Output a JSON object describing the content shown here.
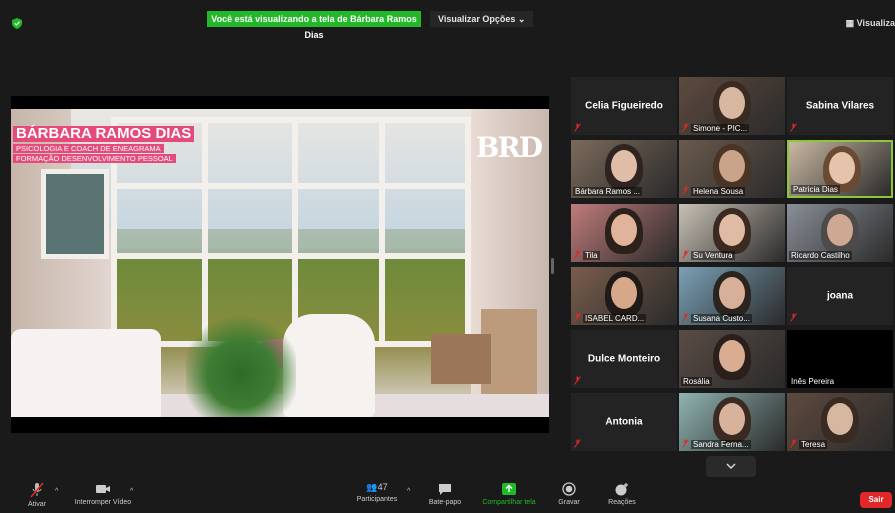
{
  "topbar": {
    "banner": "Você está visualizando a tela de Bárbara Ramos Dias",
    "view_options": "Visualizar Opções ⌄",
    "view_right": "Visualiza"
  },
  "shared_screen": {
    "brand_title": "BÁRBARA RAMOS DIAS",
    "brand_sub1": "PSICOLOGIA E COACH DE ENEAGRAMA",
    "brand_sub2": "FORMAÇÃO DESENVOLVIMENTO PESSOAL",
    "logo": "BRD"
  },
  "participants": [
    {
      "name": "Celia Figueiredo",
      "type": "name",
      "muted": true
    },
    {
      "name": "Simone - PIC...",
      "type": "video",
      "muted": true
    },
    {
      "name": "Sabina Vilares",
      "type": "name",
      "muted": true
    },
    {
      "name": "Bárbara Ramos ...",
      "type": "video",
      "muted": false
    },
    {
      "name": "Helena Sousa",
      "type": "video",
      "muted": true
    },
    {
      "name": "Patricia Dias",
      "type": "video",
      "muted": false,
      "active": true
    },
    {
      "name": "Tila",
      "type": "video",
      "muted": true
    },
    {
      "name": "Su Ventura",
      "type": "video",
      "muted": true
    },
    {
      "name": "Ricardo Castilho",
      "type": "video",
      "muted": false
    },
    {
      "name": "ISABEL CARD...",
      "type": "video",
      "muted": true
    },
    {
      "name": "Susana Custo...",
      "type": "video",
      "muted": true
    },
    {
      "name": "joana",
      "type": "name",
      "muted": true
    },
    {
      "name": "Dulce Monteiro",
      "type": "name",
      "muted": true
    },
    {
      "name": "Rosália",
      "type": "video",
      "muted": false
    },
    {
      "name": "Inês Pereira",
      "type": "video",
      "muted": false
    },
    {
      "name": "Antonia",
      "type": "name",
      "muted": true
    },
    {
      "name": "Sandra Ferna...",
      "type": "video",
      "muted": true
    },
    {
      "name": "Teresa",
      "type": "video",
      "muted": true
    }
  ],
  "toolbar": {
    "mute": "Ativar",
    "video": "Interromper Vídeo",
    "participants": "Participantes",
    "participants_count": "47",
    "chat": "Bate-papo",
    "share": "Compartilhar tela",
    "record": "Gravar",
    "reactions": "Reações",
    "leave": "Sair"
  },
  "colors": {
    "accent_green": "#23b82a",
    "leave_red": "#e02828",
    "active_border": "#8cc63f"
  }
}
